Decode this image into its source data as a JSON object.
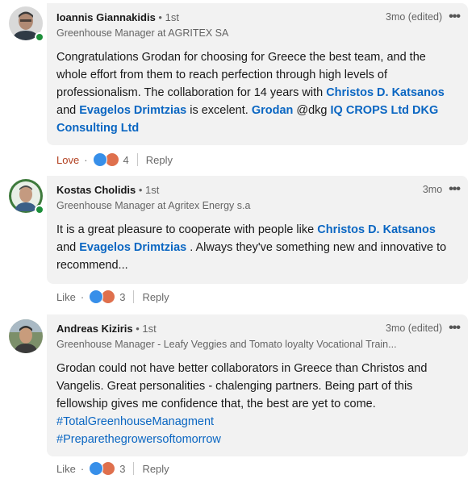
{
  "comments": [
    {
      "name": "Ioannis Giannakidis",
      "degree": " • 1st",
      "headline": "Greenhouse Manager at AGRITEX SA",
      "time": "3mo (edited)",
      "text_parts": [
        {
          "t": "Congratulations Grodan for choosing for Greece the best team, and the whole effort from them to reach perfection through high levels of professionalism. The collaboration for 14 years with ",
          "k": "plain"
        },
        {
          "t": "Christos D. Katsanos",
          "k": "mention"
        },
        {
          "t": " and ",
          "k": "plain"
        },
        {
          "t": "Evagelos Drimtzias",
          "k": "mention"
        },
        {
          "t": " is excelent. ",
          "k": "plain"
        },
        {
          "t": "Grodan",
          "k": "mention"
        },
        {
          "t": " @dkg ",
          "k": "plain"
        },
        {
          "t": "IQ CROPS Ltd",
          "k": "mention"
        },
        {
          "t": " ",
          "k": "plain"
        },
        {
          "t": "DKG Consulting Ltd",
          "k": "mention"
        }
      ],
      "reaction_label": "Love",
      "reaction_count": "4",
      "reply_label": "Reply",
      "online": true
    },
    {
      "name": "Kostas Cholidis",
      "degree": " • 1st",
      "headline": "Greenhouse Manager at Agritex Energy s.a",
      "time": "3mo",
      "text_parts": [
        {
          "t": "It is a great pleasure to cooperate with people like ",
          "k": "plain"
        },
        {
          "t": "Christos D. Katsanos",
          "k": "mention"
        },
        {
          "t": " and ",
          "k": "plain"
        },
        {
          "t": "Evagelos Drimtzias",
          "k": "mention"
        },
        {
          "t": " . Always they've something new and innovative to recommend...",
          "k": "plain"
        }
      ],
      "reaction_label": "Like",
      "reaction_count": "3",
      "reply_label": "Reply",
      "online": true
    },
    {
      "name": "Andreas Kiziris",
      "degree": " • 1st",
      "headline": "Greenhouse Manager - Leafy Veggies and Tomato loyalty Vocational Train...",
      "time": "3mo (edited)",
      "text_parts": [
        {
          "t": "Grodan could not have better collaborators in Greece than Christos and Vangelis. Great personalities - chalenging partners. Being part of this fellowship gives me confidence that, the best are yet to come.",
          "k": "plain"
        },
        {
          "t": "\n",
          "k": "br"
        },
        {
          "t": "#TotalGreenhouseManagment",
          "k": "hashtag"
        },
        {
          "t": "\n",
          "k": "br"
        },
        {
          "t": "#Preparethegrowersoftomorrow",
          "k": "hashtag"
        }
      ],
      "reaction_label": "Like",
      "reaction_count": "3",
      "reply_label": "Reply",
      "online": false
    }
  ],
  "more_menu": "•••",
  "sep": "·",
  "colors": {
    "accent": "#0a66c2",
    "love": "#b24020",
    "like_icon": "#378fe9",
    "love_icon": "#df704d",
    "bubble": "#f2f2f2",
    "online": "#1d8f3a"
  }
}
